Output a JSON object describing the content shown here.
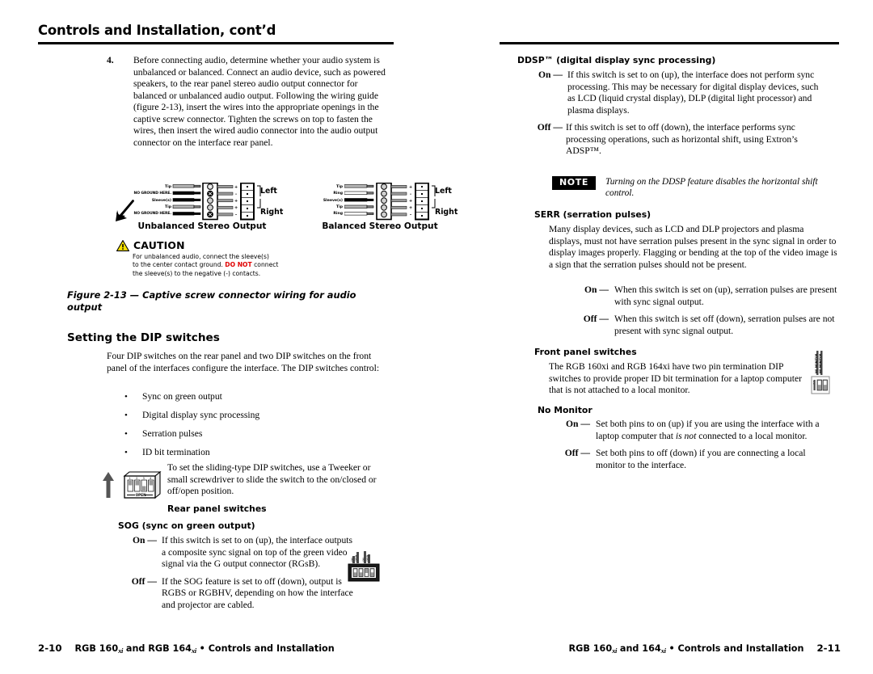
{
  "document": {
    "chapter_title": "Controls and Installation, cont’d"
  },
  "left_page": {
    "step": {
      "number": "4.",
      "text": "Before connecting audio, determine whether your audio system is unbalanced or balanced.  Connect an audio device, such as powered speakers, to the rear panel stereo audio output connector for balanced or unbalanced audio output.  Following the wiring guide (figure 2-13), insert the wires into the appropriate openings in the captive screw connector.  Tighten the screws on top to fasten the wires, then insert the wired audio connector into the audio output connector on the interface rear panel."
    },
    "figure": {
      "unbalanced_label": "Unbalanced Stereo Output",
      "balanced_label": "Balanced Stereo Output",
      "unbalanced_wires": [
        "Tip",
        "NO GROUND HERE.",
        "Sleeve(s)",
        "Tip",
        "NO GROUND HERE."
      ],
      "balanced_wires": [
        "Tip",
        "Ring",
        "Sleeve(s)",
        "Tip",
        "Ring"
      ],
      "channel_left": "Left",
      "channel_right": "Right",
      "polarity": [
        "+",
        "–",
        "+",
        "+",
        "–"
      ],
      "caption": "Figure 2-13 — Captive screw connector wiring for audio output"
    },
    "caution": {
      "title": "CAUTION",
      "line1": "For unbalanced audio, connect the sleeve(s)",
      "line2_a": "to the center contact ground. ",
      "line2_em": "DO NOT",
      "line2_b": " connect",
      "line3": "the sleeve(s) to the negative (-) contacts.",
      "warn_color": "#e00000"
    },
    "dip_section": {
      "heading": "Setting the DIP switches",
      "intro": "Four DIP switches on the rear panel and two DIP switches on the front panel of the interfaces configure the interface.  The DIP switches control:",
      "bullets": [
        "Sync on green output",
        "Digital display sync processing",
        "Serration pulses",
        "ID bit termination"
      ],
      "tool_text": "To set the sliding-type DIP switches, use a Tweeker or small screwdriver to slide the switch to the on/closed or off/open position.",
      "switch_numbers": [
        "1",
        "2",
        "3",
        "4"
      ],
      "open_label": "OPEN",
      "rear_panel_heading": "Rear panel switches"
    },
    "sog": {
      "heading": "SOG (sync on green output)",
      "on_label": "On —",
      "on_text": "If this switch is set to on (up), the interface outputs a composite sync signal on top of the green video signal via the G output connector (RGsB).",
      "off_label": "Off —",
      "off_text": "If the SOG feature is set to off (down), output is RGBS or RGBHV, depending on how the interface and projector are cabled."
    },
    "footer": {
      "page": "2-10",
      "text_a": "RGB 160",
      "xi": "xi",
      "text_b": " and RGB 164",
      "text_c": " • Controls and Installation"
    }
  },
  "right_page": {
    "ddsp": {
      "heading": "DDSP™ (digital display sync processing)",
      "on_label": "On —",
      "on_text": "If this switch is set to on (up), the interface does not perform sync processing.  This may be necessary for digital display devices, such as LCD (liquid crystal display), DLP (digital light processor) and plasma displays.",
      "off_label": "Off —",
      "off_text": "If this switch is set to off (down), the interface performs sync processing operations, such as horizontal shift, using Extron’s ADSP™."
    },
    "note": {
      "badge": "NOTE",
      "text": "Turning on the DDSP feature disables the horizontal shift control."
    },
    "serr": {
      "heading": "SERR (serration pulses)",
      "intro": "Many display devices, such as LCD and DLP projectors and plasma displays, must not have serration pulses present in the sync signal in order to display images properly.  Flagging or bending at the top of the video image is a sign that the serration pulses should not be present.",
      "on_label": "On —",
      "on_text": "When this switch is set on (up), serration pulses are present with sync signal output.",
      "off_label": "Off —",
      "off_text": "When this switch is set off (down), serration pulses are not present with sync signal output."
    },
    "front_panel": {
      "heading": "Front panel switches",
      "intro": "The RGB 160xi and RGB 164xi have two pin termination DIP switches to provide proper ID bit termination for a laptop computer that is not attached to a local monitor.",
      "switch_labels": [
        "NO MONITOR",
        "NO MONITOR"
      ],
      "on_label_vertical": "ON"
    },
    "no_monitor": {
      "heading": "No Monitor",
      "on_label": "On —",
      "on_text_a": "Set both pins to on (up) if you are using the interface with a laptop computer that ",
      "on_text_em": "is not",
      "on_text_b": " connected to a local monitor.",
      "off_label": "Off —",
      "off_text": "Set both pins to off (down) if you are connecting a local monitor to the interface."
    },
    "footer": {
      "page": "2-11",
      "text_a": "RGB 160",
      "xi": "xi",
      "text_b": " and 164",
      "text_c": " • Controls and Installation"
    }
  }
}
